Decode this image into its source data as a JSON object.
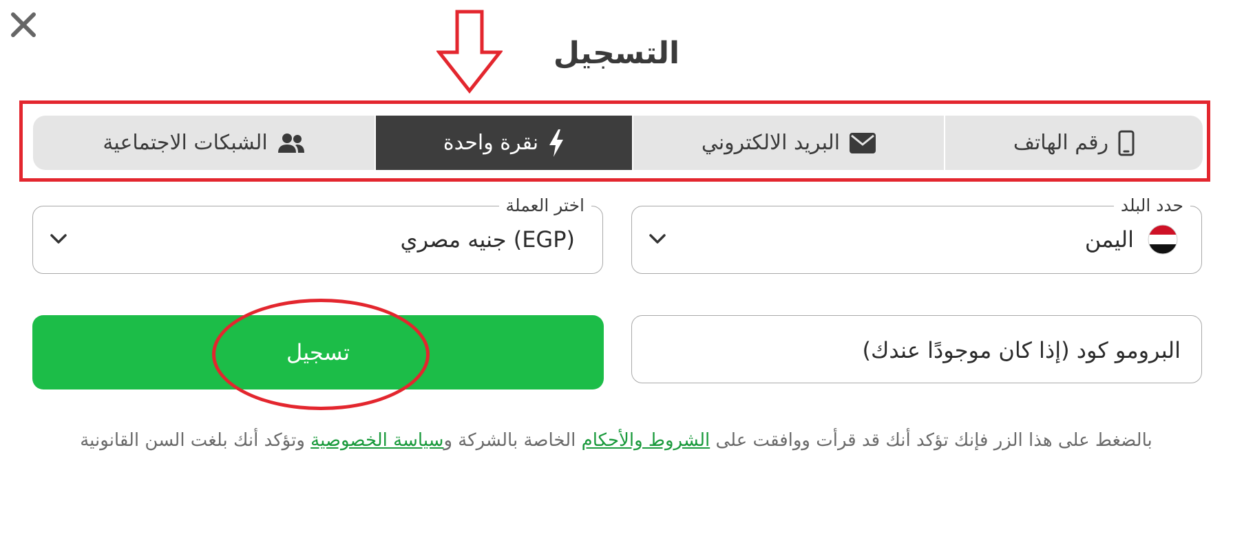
{
  "dialog": {
    "title": "التسجيل",
    "close_label": "close"
  },
  "tabs": [
    {
      "label": "رقم الهاتف",
      "icon": "mobile-phone-icon",
      "active": false
    },
    {
      "label": "البريد الالكتروني",
      "icon": "envelope-icon",
      "active": false
    },
    {
      "label": "نقرة واحدة",
      "icon": "lightning-bolt-icon",
      "active": true
    },
    {
      "label": "الشبكات الاجتماعية",
      "icon": "users-icon",
      "active": false
    }
  ],
  "country": {
    "label": "حدد البلد",
    "value": "اليمن",
    "flag_icon": "yemen-flag-icon"
  },
  "currency": {
    "label": "اختر العملة",
    "value": "جنيه مصري (EGP)"
  },
  "promo": {
    "placeholder": "البرومو كود (إذا كان موجودًا عندك)"
  },
  "register_button": {
    "label": "تسجيل"
  },
  "terms": {
    "part1": "بالضغط على هذا الزر فإنك تؤكد أنك قد قرأت ووافقت على ",
    "terms_link": "الشروط والأحكام",
    "part2": " الخاصة بالشركة و",
    "privacy_link": "سياسة الخصوصية",
    "part3": " وتؤكد أنك بلغت السن القانونية"
  },
  "colors": {
    "accent_green": "#1cbd48",
    "active_tab": "#3d3d3d",
    "tab_bg": "#e5e5e5",
    "annotation_red": "#e3262e",
    "link_green": "#1a9a3c"
  }
}
